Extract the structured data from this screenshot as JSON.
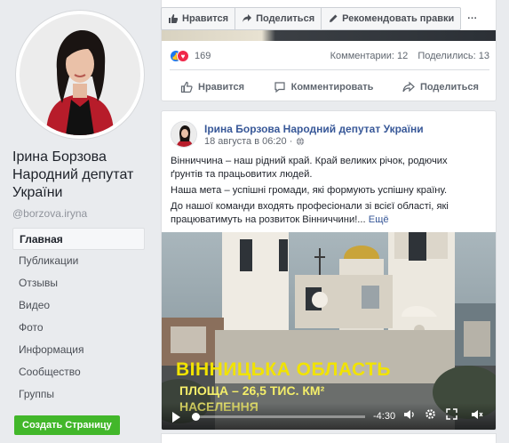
{
  "profile": {
    "name": "Ірина Борзова Народний депутат України",
    "username": "@borzova.iryna"
  },
  "nav": {
    "items": [
      "Главная",
      "Публикации",
      "Отзывы",
      "Видео",
      "Фото",
      "Информация",
      "Сообщество",
      "Группы"
    ],
    "create_page": "Создать Страницу"
  },
  "action_bar": {
    "like": "Нравится",
    "share": "Поделиться",
    "recommend": "Рекомендовать правки",
    "more": "···"
  },
  "top_post": {
    "reaction_count": "169",
    "comments": "Комментарии: 12",
    "shares": "Поделились: 13",
    "actions": [
      "Нравится",
      "Комментировать",
      "Поделиться"
    ]
  },
  "post": {
    "author": "Ірина Борзова Народний депутат України",
    "date": "18 августа в 06:20 ·",
    "paragraph1": "Вінниччина – наш рідний край. Край великих річок, родючих ґрунтів та працьовитих людей.",
    "paragraph2": "Наша мета – успішні громади, які формують успішну країну.",
    "paragraph3": "До нашої команди входять професіонали зі всієї області, які працюватимуть на розвиток Вінниччини!...",
    "see_more": "Ещё"
  },
  "video": {
    "title": "ВІННИЦЬКА ОБЛАСТЬ",
    "line1": "ПЛОЩА – 26,5 ТИС. КМ²",
    "line2": "НАСЕЛЕННЯ",
    "time": "-4:30",
    "progress": 0.02
  }
}
